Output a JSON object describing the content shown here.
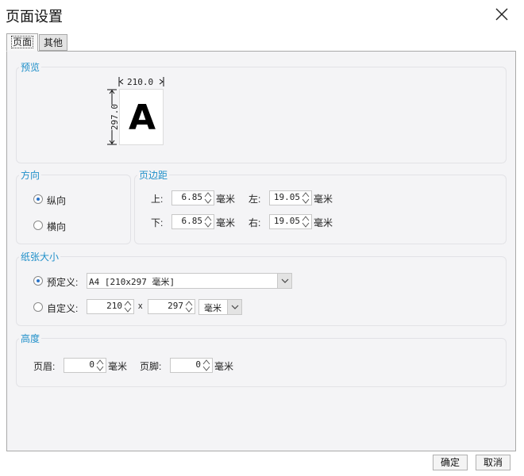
{
  "window": {
    "title": "页面设置",
    "close_icon": "close-icon"
  },
  "tabs": [
    {
      "label": "页面",
      "active": true
    },
    {
      "label": "其他",
      "active": false
    }
  ],
  "preview": {
    "title": "预览",
    "width": "210.0",
    "height": "297.0",
    "letter": "A"
  },
  "orientation": {
    "title": "方向",
    "portrait": {
      "label": "纵向",
      "checked": true
    },
    "landscape": {
      "label": "横向",
      "checked": false
    }
  },
  "margins": {
    "title": "页边距",
    "top": {
      "label": "上:",
      "value": "6.85",
      "unit": "毫米"
    },
    "left": {
      "label": "左:",
      "value": "19.05",
      "unit": "毫米"
    },
    "bottom": {
      "label": "下:",
      "value": "6.85",
      "unit": "毫米"
    },
    "right": {
      "label": "右:",
      "value": "19.05",
      "unit": "毫米"
    }
  },
  "paper": {
    "title": "纸张大小",
    "preset": {
      "label": "预定义:",
      "checked": true,
      "value": "A4 [210x297 毫米]"
    },
    "custom": {
      "label": "自定义:",
      "checked": false,
      "width": "210",
      "sep": "x",
      "height": "297",
      "unit": "毫米"
    }
  },
  "height": {
    "title": "高度",
    "header": {
      "label": "页眉:",
      "value": "0",
      "unit": "毫米"
    },
    "footer": {
      "label": "页脚:",
      "value": "0",
      "unit": "毫米"
    }
  },
  "footer_buttons": {
    "ok": "确定",
    "cancel": "取消"
  },
  "colors": {
    "accent": "#1f8fc9",
    "panel_bg": "#f4f4f6",
    "radio_dot": "#2a73c8"
  }
}
